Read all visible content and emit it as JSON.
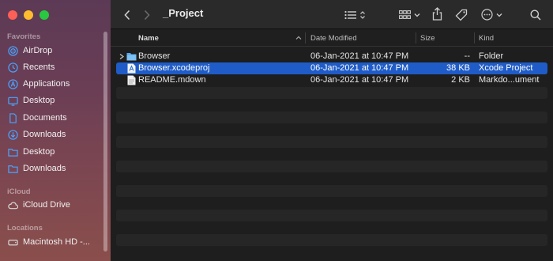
{
  "window": {
    "title": "_Project"
  },
  "sidebar": {
    "sections": [
      {
        "title": "Favorites",
        "items": [
          {
            "label": "AirDrop",
            "icon": "airdrop-icon"
          },
          {
            "label": "Recents",
            "icon": "clock-icon"
          },
          {
            "label": "Applications",
            "icon": "applications-icon"
          },
          {
            "label": "Desktop",
            "icon": "desktop-icon"
          },
          {
            "label": "Documents",
            "icon": "document-icon"
          },
          {
            "label": "Downloads",
            "icon": "download-icon"
          },
          {
            "label": "Desktop",
            "icon": "folder-icon"
          },
          {
            "label": "Downloads",
            "icon": "folder-icon"
          }
        ]
      },
      {
        "title": "iCloud",
        "items": [
          {
            "label": "iCloud Drive",
            "icon": "cloud-icon"
          }
        ]
      },
      {
        "title": "Locations",
        "items": [
          {
            "label": "Macintosh HD -...",
            "icon": "disk-icon"
          }
        ]
      }
    ]
  },
  "columns": {
    "name": "Name",
    "date": "Date Modified",
    "size": "Size",
    "kind": "Kind"
  },
  "files": [
    {
      "name": "Browser",
      "date": "06-Jan-2021 at 10:47 PM",
      "size": "--",
      "kind": "Folder",
      "icon": "folder-icon",
      "selected": false,
      "expandable": true
    },
    {
      "name": "Browser.xcodeproj",
      "date": "06-Jan-2021 at 10:47 PM",
      "size": "38 KB",
      "kind": "Xcode Project",
      "icon": "xcode-project-icon",
      "selected": true,
      "expandable": false
    },
    {
      "name": "README.mdown",
      "date": "06-Jan-2021 at 10:47 PM",
      "size": "2 KB",
      "kind": "Markdo...ument",
      "icon": "document-icon",
      "selected": false,
      "expandable": false
    }
  ],
  "colors": {
    "selection": "#1f5cc7",
    "sidebar_icon": "#4aa3ff"
  }
}
